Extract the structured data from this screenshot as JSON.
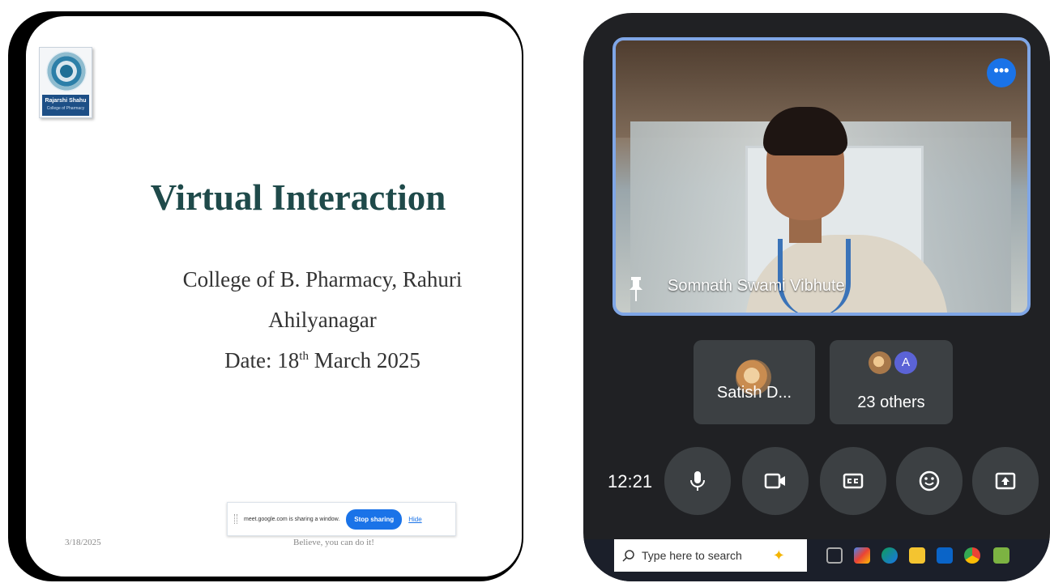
{
  "slide": {
    "logo_text": "Rajarshi Shahu",
    "logo_subtext": "College of Pharmacy",
    "title": "Virtual Interaction",
    "college": "College of B. Pharmacy, Rahuri",
    "city": "Ahilyanagar",
    "date_prefix": "Date: 18",
    "date_sup": "th",
    "date_suffix": " March 2025",
    "footer_date": "3/18/2025",
    "footer_text": "Believe, you can do it!"
  },
  "share_bar": {
    "message": "meet.google.com is sharing a window.",
    "stop_label": "Stop sharing",
    "hide_label": "Hide"
  },
  "meet": {
    "speaker_name": "Somnath Swami Vibhute",
    "more_label": "•••",
    "participants": [
      {
        "label": "Satish D..."
      },
      {
        "label": "23 others",
        "avatar_letter": "A"
      }
    ],
    "clock": "12:21",
    "controls": [
      "microphone",
      "camera",
      "captions",
      "emoji",
      "present"
    ]
  },
  "taskbar": {
    "search_placeholder": "Type here to search"
  },
  "colors": {
    "accent": "#1a73e8",
    "meet_bg": "#202124",
    "tile_bg": "#3c4043",
    "slide_title": "#1f4a4a"
  }
}
